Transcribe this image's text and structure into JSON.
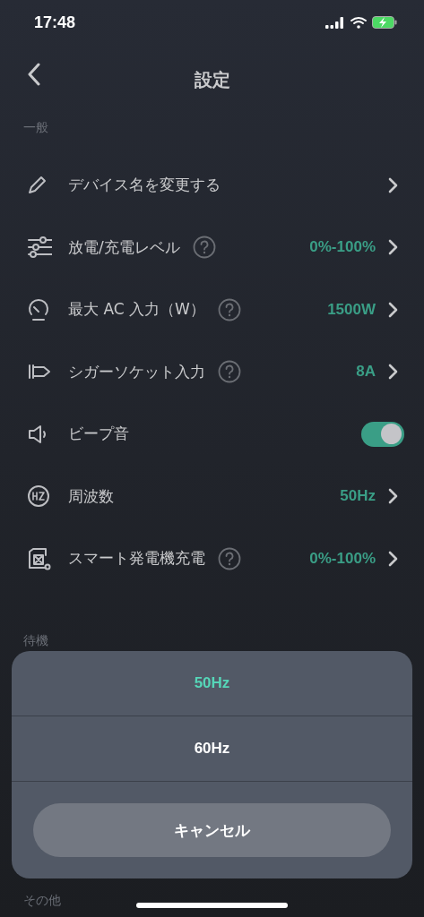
{
  "status_bar": {
    "time": "17:48"
  },
  "header": {
    "title": "設定"
  },
  "sections": [
    {
      "title": "一般",
      "rows": [
        {
          "kind": "nav",
          "label": "デバイス名を変更する",
          "help": false
        },
        {
          "kind": "nav",
          "label": "放電/充電レベル",
          "help": true,
          "value": "0%-100%"
        },
        {
          "kind": "nav",
          "label": "最大 AC 入力（W）",
          "help": true,
          "value": "1500W"
        },
        {
          "kind": "nav",
          "label": "シガーソケット入力",
          "help": true,
          "value": "8A"
        },
        {
          "kind": "toggle",
          "label": "ビープ音",
          "help": false,
          "on": true
        },
        {
          "kind": "nav",
          "label": "周波数",
          "help": false,
          "value": "50Hz"
        },
        {
          "kind": "nav",
          "label": "スマート発電機充電",
          "help": true,
          "value": "0%-100%"
        }
      ]
    },
    {
      "title": "待機"
    },
    {
      "title": "その他"
    }
  ],
  "sheet": {
    "options": [
      {
        "label": "50Hz",
        "selected": true
      },
      {
        "label": "60Hz",
        "selected": false
      }
    ],
    "cancel": "キャンセル"
  }
}
